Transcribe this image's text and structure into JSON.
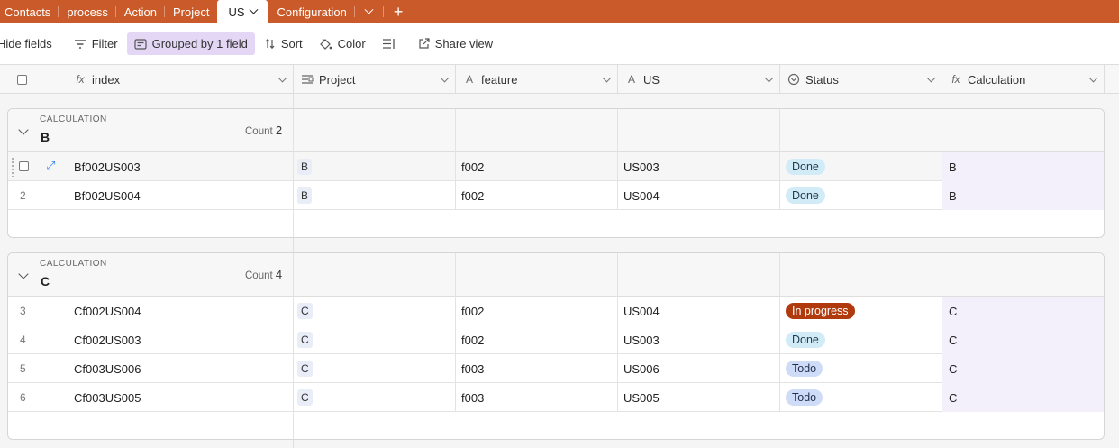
{
  "tabs": [
    {
      "label": "Contacts"
    },
    {
      "label": "process"
    },
    {
      "label": "Action"
    },
    {
      "label": "Project"
    },
    {
      "label": "US"
    },
    {
      "label": "Configuration"
    }
  ],
  "toolbar": {
    "hide_fields": "Hide fields",
    "filter": "Filter",
    "grouped": "Grouped by 1 field",
    "sort": "Sort",
    "color": "Color",
    "share_view": "Share view"
  },
  "columns": [
    {
      "label": "index",
      "icon": "formula-icon"
    },
    {
      "label": "Project",
      "icon": "link-icon"
    },
    {
      "label": "feature",
      "icon": "text-icon"
    },
    {
      "label": "US",
      "icon": "text-icon"
    },
    {
      "label": "Status",
      "icon": "status-icon"
    },
    {
      "label": "Calculation",
      "icon": "formula-icon"
    }
  ],
  "groups": [
    {
      "field": "CALCULATION",
      "value": "B",
      "count_label": "Count",
      "count": "2",
      "rows": [
        {
          "num": "1",
          "index": "Bf002US003",
          "project": "B",
          "feature": "f002",
          "us": "US003",
          "status": "Done",
          "calculation": "B"
        },
        {
          "num": "2",
          "index": "Bf002US004",
          "project": "B",
          "feature": "f002",
          "us": "US004",
          "status": "Done",
          "calculation": "B"
        }
      ]
    },
    {
      "field": "CALCULATION",
      "value": "C",
      "count_label": "Count",
      "count": "4",
      "rows": [
        {
          "num": "3",
          "index": "Cf002US004",
          "project": "C",
          "feature": "f002",
          "us": "US004",
          "status": "In progress",
          "calculation": "C"
        },
        {
          "num": "4",
          "index": "Cf002US003",
          "project": "C",
          "feature": "f002",
          "us": "US003",
          "status": "Done",
          "calculation": "C"
        },
        {
          "num": "5",
          "index": "Cf003US006",
          "project": "C",
          "feature": "f003",
          "us": "US006",
          "status": "Todo",
          "calculation": "C"
        },
        {
          "num": "6",
          "index": "Cf003US005",
          "project": "C",
          "feature": "f003",
          "us": "US005",
          "status": "Todo",
          "calculation": "C"
        }
      ]
    }
  ],
  "status_colors": {
    "Done": {
      "bg": "#d1ecf7",
      "fg": "#1f3b4d"
    },
    "Todo": {
      "bg": "#cfdcf7",
      "fg": "#1f2f4d"
    },
    "In progress": {
      "bg": "#b03a0e",
      "fg": "#ffffff"
    }
  },
  "colors": {
    "tabbar": "#cb5a2a",
    "accent": "#2d7ff9",
    "grouped_highlight": "#e3d7f5"
  }
}
